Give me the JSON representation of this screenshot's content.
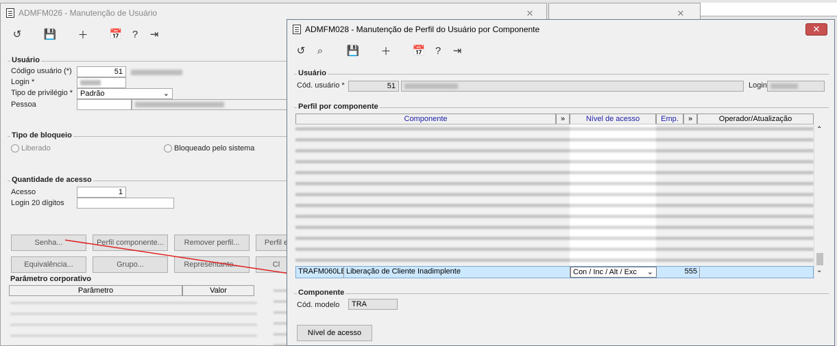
{
  "bg_window": {
    "title": "ADMFM026 - Manutenção de Usuário",
    "usuario_group": "Usuário",
    "codigo_label": "Código usuário (*)",
    "codigo_value": "51",
    "login_label": "Login *",
    "privilegio_label": "Tipo de privilégio *",
    "privilegio_value": "Padrão",
    "pessoa_label": "Pessoa",
    "bloqueio_group": "Tipo de bloqueio",
    "liberado_label": "Liberado",
    "bloqueado_label": "Bloqueado pelo sistema",
    "quantidade_group": "Quantidade de acesso",
    "acesso_label": "Acesso",
    "acesso_value": "1",
    "login20_label": "Login 20 dígitos",
    "buttons": {
      "senha": "Senha...",
      "perfil_componente": "Perfil componente...",
      "remover_perfil": "Remover perfil...",
      "perfil_e": "Perfil e",
      "equivalencia": "Equivalência...",
      "grupo": "Grupo...",
      "representante": "Representante...",
      "cl": "Cl"
    },
    "param_group": "Parâmetro corporativo",
    "param_col": "Parâmetro",
    "valor_col": "Valor"
  },
  "fg_window": {
    "title": "ADMFM028 - Manutenção de Perfil do Usuário por Componente",
    "usuario_group": "Usuário",
    "cod_usuario_label": "Cód. usuário *",
    "cod_usuario_value": "51",
    "login_label": "Login *",
    "perfil_group": "Perfil por componente",
    "columns": {
      "componente": "Componente",
      "expand1": "»",
      "nivel": "Nível de acesso",
      "emp": "Emp.",
      "expand2": "»",
      "operador": "Operador/Atualização"
    },
    "selected_row": {
      "code": "TRAFM060LB",
      "description": "Liberação de Cliente Inadimplente",
      "nivel": "Con / Inc / Alt / Exc",
      "emp": "555"
    },
    "componente_group": "Componente",
    "cod_modelo_label": "Cód. modelo",
    "cod_modelo_value": "TRA",
    "nivel_button": "Nível de acesso"
  },
  "colors": {
    "selected_row": "#cce8ff",
    "close_red": "#c75050",
    "header_blue": "#1a1aa6",
    "arrow": "#e02020"
  }
}
